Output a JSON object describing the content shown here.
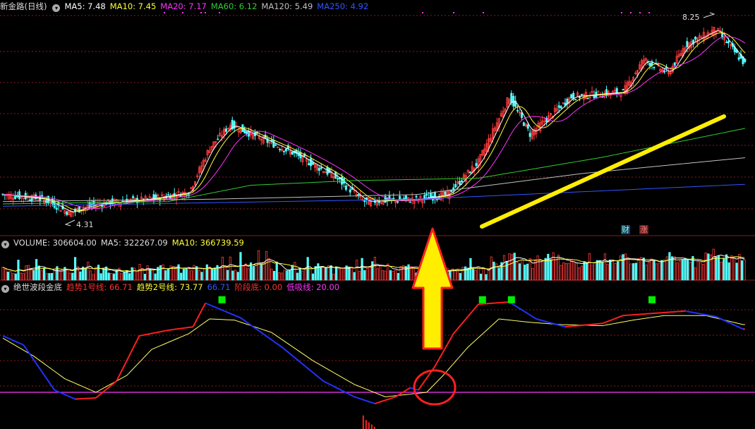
{
  "colors": {
    "up": "#ff3b3b",
    "down": "#54ffff",
    "ma5": "#ffffff",
    "ma10": "#ffff33",
    "ma20": "#ff33ff",
    "ma60": "#33cc33",
    "ma120": "#c0c0c0",
    "ma250": "#3355ff",
    "grid": "#8b1a1a",
    "trend_up": "#ff2020",
    "trend_down": "#2233ff",
    "trend2": "#ffff66",
    "low_line": "#ff33ff",
    "signal": "#00ee00",
    "highlight": "#ffee00"
  },
  "price_panel": {
    "title": "新金路(日线)",
    "ma_legend": [
      {
        "label": "MA5: 7.48",
        "color": "#ffffff"
      },
      {
        "label": "MA10: 7.45",
        "color": "#ffff33"
      },
      {
        "label": "MA20: 7.17",
        "color": "#ff33ff"
      },
      {
        "label": "MA60: 6.12",
        "color": "#33cc33"
      },
      {
        "label": "MA120: 5.49",
        "color": "#c0c0c0"
      },
      {
        "label": "MA250: 4.92",
        "color": "#3355ff"
      }
    ],
    "high_label": "8.25",
    "low_label": "4.31",
    "cai_label": "财",
    "zhang_label": "涨"
  },
  "volume_panel": {
    "legend": [
      {
        "label": "VOLUME: 306604.00",
        "color": "#dddddd"
      },
      {
        "label": "MA5: 322267.09",
        "color": "#dddddd"
      },
      {
        "label": "MA10: 366739.59",
        "color": "#ffff33"
      }
    ]
  },
  "indicator_panel": {
    "legend": [
      {
        "label": "绝世波段金底",
        "color": "#dddddd"
      },
      {
        "label": "趋势1号线: 66.71",
        "color": "#ff3030"
      },
      {
        "label": "趋势2号线: 73.77",
        "color": "#ffff33"
      },
      {
        "label": "66.71",
        "color": "#3355ff"
      },
      {
        "label": "阶段底: 0.00",
        "color": "#ff3030"
      },
      {
        "label": "低吸线: 20.00",
        "color": "#ff33ff"
      }
    ]
  },
  "chart_data": [
    {
      "type": "candlestick",
      "name": "price",
      "ylim": [
        4.0,
        8.6
      ],
      "series": [
        {
          "name": "MA5",
          "values": []
        },
        {
          "name": "MA10",
          "values": []
        },
        {
          "name": "MA20",
          "values": []
        },
        {
          "name": "MA60",
          "values": []
        },
        {
          "name": "MA120",
          "values": []
        },
        {
          "name": "MA250",
          "values": []
        }
      ],
      "last_values": {
        "MA5": 7.48,
        "MA10": 7.45,
        "MA20": 7.17,
        "MA60": 6.12,
        "MA120": 5.49,
        "MA250": 4.92
      },
      "high": 8.25,
      "low": 4.31
    },
    {
      "type": "bar",
      "name": "volume",
      "last": {
        "VOLUME": 306604.0,
        "MA5": 322267.09,
        "MA10": 366739.59
      }
    },
    {
      "type": "line",
      "name": "indicator",
      "ylim": [
        0,
        110
      ],
      "trend1_keypoints": [
        [
          0,
          70
        ],
        [
          10,
          62
        ],
        [
          25,
          22
        ],
        [
          35,
          14
        ],
        [
          45,
          15
        ],
        [
          55,
          30
        ],
        [
          66,
          70
        ],
        [
          80,
          75
        ],
        [
          92,
          78
        ],
        [
          98,
          99
        ],
        [
          115,
          86
        ],
        [
          135,
          60
        ],
        [
          155,
          30
        ],
        [
          170,
          16
        ],
        [
          180,
          10
        ],
        [
          190,
          16
        ],
        [
          197,
          24
        ],
        [
          201,
          22
        ],
        [
          209,
          43
        ],
        [
          218,
          72
        ],
        [
          230,
          98
        ],
        [
          245,
          100
        ],
        [
          258,
          85
        ],
        [
          272,
          78
        ],
        [
          290,
          81
        ],
        [
          300,
          88
        ],
        [
          315,
          90
        ],
        [
          330,
          92
        ],
        [
          345,
          87
        ],
        [
          358,
          76
        ]
      ],
      "trend2_keypoints": [
        [
          0,
          68
        ],
        [
          15,
          52
        ],
        [
          30,
          32
        ],
        [
          45,
          20
        ],
        [
          60,
          35
        ],
        [
          72,
          58
        ],
        [
          90,
          72
        ],
        [
          100,
          85
        ],
        [
          112,
          84
        ],
        [
          130,
          73
        ],
        [
          150,
          48
        ],
        [
          170,
          27
        ],
        [
          185,
          16
        ],
        [
          195,
          18
        ],
        [
          205,
          20
        ],
        [
          213,
          35
        ],
        [
          225,
          60
        ],
        [
          240,
          85
        ],
        [
          255,
          82
        ],
        [
          270,
          80
        ],
        [
          290,
          79
        ],
        [
          305,
          84
        ],
        [
          320,
          88
        ],
        [
          340,
          88
        ],
        [
          358,
          80
        ]
      ],
      "last": {
        "trend1": 66.71,
        "trend2": 73.77,
        "stage_bottom": 0.0,
        "low_buy": 20.0
      },
      "low_line": 20.0,
      "signal_marks_at": [
        106,
        232,
        246,
        314
      ],
      "stage_bottom_bars": {
        "start": 174,
        "heights": [
          6,
          4,
          3,
          2,
          1
        ]
      }
    }
  ]
}
